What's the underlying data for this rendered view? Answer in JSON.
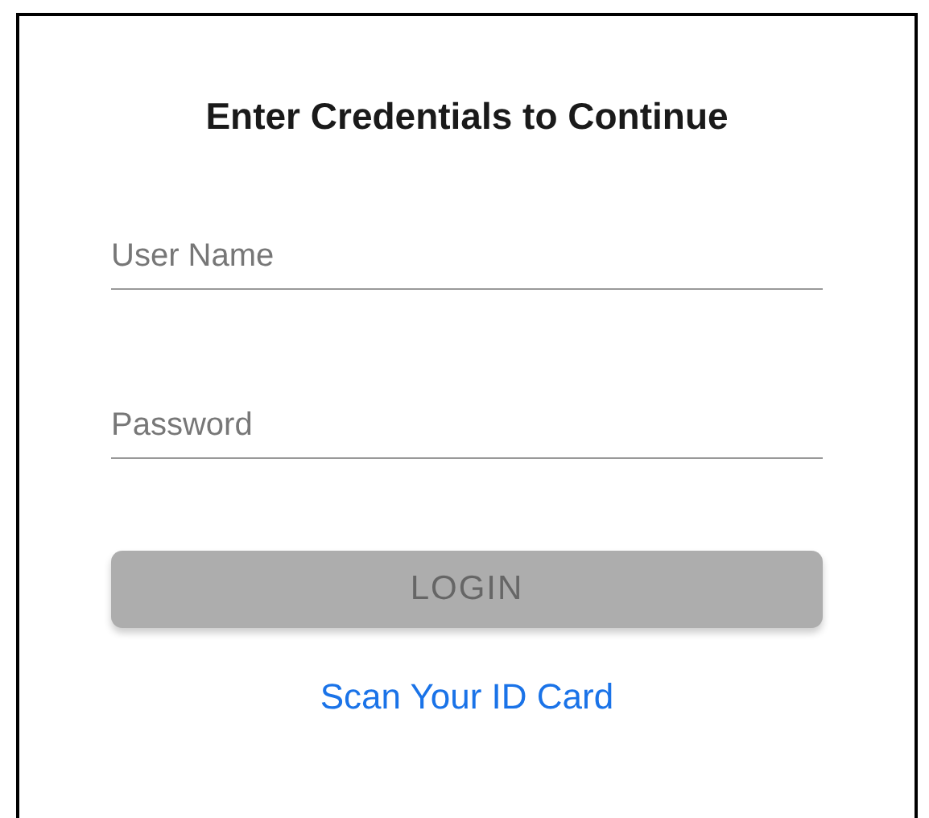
{
  "title": "Enter Credentials to Continue",
  "fields": [
    {
      "placeholder": "User Name"
    },
    {
      "placeholder": "Password"
    }
  ],
  "login_button": {
    "label": "LOGIN",
    "disabled": true
  },
  "scan_link": {
    "label": "Scan Your ID Card"
  }
}
